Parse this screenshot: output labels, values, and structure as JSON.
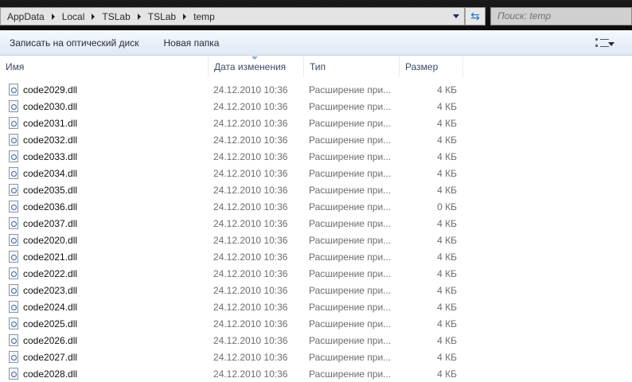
{
  "address": {
    "crumbs": [
      "AppData",
      "Local",
      "TSLab",
      "TSLab",
      "temp"
    ]
  },
  "search": {
    "placeholder": "Поиск: temp"
  },
  "icons": {
    "refresh": "refresh-icon",
    "views": "view-options-icon",
    "file": "dll-file-icon"
  },
  "toolbar": {
    "burn": "Записать на оптический диск",
    "new_folder": "Новая папка"
  },
  "columns": {
    "name": "Имя",
    "date": "Дата изменения",
    "type": "Тип",
    "size": "Размер"
  },
  "files": [
    {
      "name": "code2029.dll",
      "date": "24.12.2010 10:36",
      "type": "Расширение при...",
      "size": "4 КБ"
    },
    {
      "name": "code2030.dll",
      "date": "24.12.2010 10:36",
      "type": "Расширение при...",
      "size": "4 КБ"
    },
    {
      "name": "code2031.dll",
      "date": "24.12.2010 10:36",
      "type": "Расширение при...",
      "size": "4 КБ"
    },
    {
      "name": "code2032.dll",
      "date": "24.12.2010 10:36",
      "type": "Расширение при...",
      "size": "4 КБ"
    },
    {
      "name": "code2033.dll",
      "date": "24.12.2010 10:36",
      "type": "Расширение при...",
      "size": "4 КБ"
    },
    {
      "name": "code2034.dll",
      "date": "24.12.2010 10:36",
      "type": "Расширение при...",
      "size": "4 КБ"
    },
    {
      "name": "code2035.dll",
      "date": "24.12.2010 10:36",
      "type": "Расширение при...",
      "size": "4 КБ"
    },
    {
      "name": "code2036.dll",
      "date": "24.12.2010 10:36",
      "type": "Расширение при...",
      "size": "0 КБ"
    },
    {
      "name": "code2037.dll",
      "date": "24.12.2010 10:36",
      "type": "Расширение при...",
      "size": "4 КБ"
    },
    {
      "name": "code2020.dll",
      "date": "24.12.2010 10:36",
      "type": "Расширение при...",
      "size": "4 КБ"
    },
    {
      "name": "code2021.dll",
      "date": "24.12.2010 10:36",
      "type": "Расширение при...",
      "size": "4 КБ"
    },
    {
      "name": "code2022.dll",
      "date": "24.12.2010 10:36",
      "type": "Расширение при...",
      "size": "4 КБ"
    },
    {
      "name": "code2023.dll",
      "date": "24.12.2010 10:36",
      "type": "Расширение при...",
      "size": "4 КБ"
    },
    {
      "name": "code2024.dll",
      "date": "24.12.2010 10:36",
      "type": "Расширение при...",
      "size": "4 КБ"
    },
    {
      "name": "code2025.dll",
      "date": "24.12.2010 10:36",
      "type": "Расширение при...",
      "size": "4 КБ"
    },
    {
      "name": "code2026.dll",
      "date": "24.12.2010 10:36",
      "type": "Расширение при...",
      "size": "4 КБ"
    },
    {
      "name": "code2027.dll",
      "date": "24.12.2010 10:36",
      "type": "Расширение при...",
      "size": "4 КБ"
    },
    {
      "name": "code2028.dll",
      "date": "24.12.2010 10:36",
      "type": "Расширение при...",
      "size": "4 КБ"
    }
  ]
}
